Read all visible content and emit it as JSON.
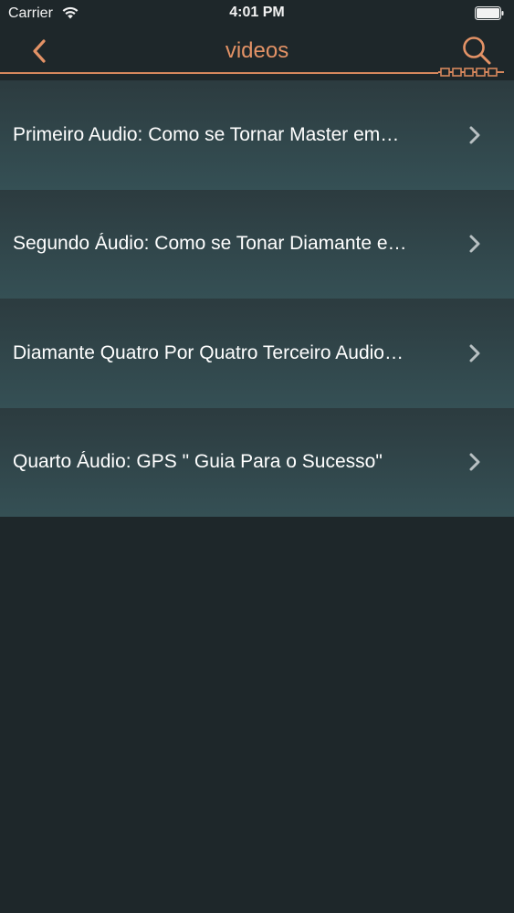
{
  "status_bar": {
    "carrier": "Carrier",
    "time": "4:01 PM"
  },
  "nav": {
    "title": "videos",
    "accent_color": "#e39266"
  },
  "list": {
    "items": [
      {
        "label": "Primeiro Audio: Como se Tornar Master em…"
      },
      {
        "label": "Segundo Áudio: Como se Tonar Diamante e…"
      },
      {
        "label": "Diamante Quatro Por Quatro Terceiro Audio…"
      },
      {
        "label": "Quarto Áudio: GPS \" Guia Para o Sucesso\""
      }
    ]
  },
  "icons": {
    "back": "chevron-left-icon",
    "search": "search-icon",
    "row_disclosure": "chevron-right-icon"
  }
}
